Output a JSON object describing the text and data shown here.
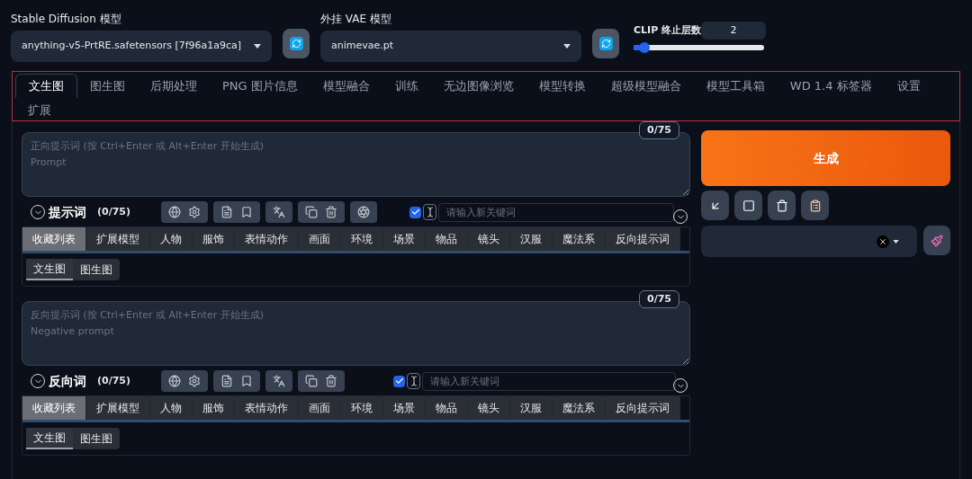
{
  "model_select": {
    "label": "Stable Diffusion 模型",
    "value": "anything-v5-PrtRE.safetensors [7f96a1a9ca]"
  },
  "vae_select": {
    "label": "外挂 VAE 模型",
    "value": "animevae.pt"
  },
  "clip_skip": {
    "label": "CLIP 终止层数",
    "value": "2",
    "level": 0.08
  },
  "tabs": [
    {
      "label": "文生图",
      "selected": true
    },
    {
      "label": "图生图",
      "selected": false
    },
    {
      "label": "后期处理",
      "selected": false
    },
    {
      "label": "PNG 图片信息",
      "selected": false
    },
    {
      "label": "模型融合",
      "selected": false
    },
    {
      "label": "训练",
      "selected": false
    },
    {
      "label": "无边图像浏览",
      "selected": false
    },
    {
      "label": "模型转换",
      "selected": false
    },
    {
      "label": "超级模型融合",
      "selected": false
    },
    {
      "label": "模型工具箱",
      "selected": false
    },
    {
      "label": "WD 1.4 标签器",
      "selected": false
    },
    {
      "label": "设置",
      "selected": false
    },
    {
      "label": "扩展",
      "selected": false
    }
  ],
  "prompts": [
    {
      "counter": "0/75",
      "placeholder": "正向提示词 (按 Ctrl+Enter 或 Alt+Enter 开始生成)\nPrompt",
      "title": "提示词",
      "count": "(0/75)",
      "extra_tool": true,
      "keyword_enabled": true,
      "keyword_placeholder": "请输入新关键词",
      "categories": [
        {
          "label": "收藏列表",
          "selected": true
        },
        {
          "label": "扩展模型",
          "selected": false
        },
        {
          "label": "人物",
          "selected": false
        },
        {
          "label": "服饰",
          "selected": false
        },
        {
          "label": "表情动作",
          "selected": false
        },
        {
          "label": "画面",
          "selected": false
        },
        {
          "label": "环境",
          "selected": false
        },
        {
          "label": "场景",
          "selected": false
        },
        {
          "label": "物品",
          "selected": false
        },
        {
          "label": "镜头",
          "selected": false
        },
        {
          "label": "汉服",
          "selected": false
        },
        {
          "label": "魔法系",
          "selected": false
        },
        {
          "label": "反向提示词",
          "selected": false
        }
      ],
      "subtabs": [
        {
          "label": "文生图",
          "selected": true
        },
        {
          "label": "图生图",
          "selected": false
        }
      ]
    },
    {
      "counter": "0/75",
      "placeholder": "反向提示词 (按 Ctrl+Enter 或 Alt+Enter 开始生成)\nNegative prompt",
      "title": "反向词",
      "count": "(0/75)",
      "extra_tool": false,
      "keyword_enabled": true,
      "keyword_placeholder": "请输入新关键词",
      "categories": [
        {
          "label": "收藏列表",
          "selected": true
        },
        {
          "label": "扩展模型",
          "selected": false
        },
        {
          "label": "人物",
          "selected": false
        },
        {
          "label": "服饰",
          "selected": false
        },
        {
          "label": "表情动作",
          "selected": false
        },
        {
          "label": "画面",
          "selected": false
        },
        {
          "label": "环境",
          "selected": false
        },
        {
          "label": "场景",
          "selected": false
        },
        {
          "label": "物品",
          "selected": false
        },
        {
          "label": "镜头",
          "selected": false
        },
        {
          "label": "汉服",
          "selected": false
        },
        {
          "label": "魔法系",
          "selected": false
        },
        {
          "label": "反向提示词",
          "selected": false
        }
      ],
      "subtabs": [
        {
          "label": "文生图",
          "selected": true
        },
        {
          "label": "图生图",
          "selected": false
        }
      ]
    }
  ],
  "generate": {
    "label": "生成"
  }
}
